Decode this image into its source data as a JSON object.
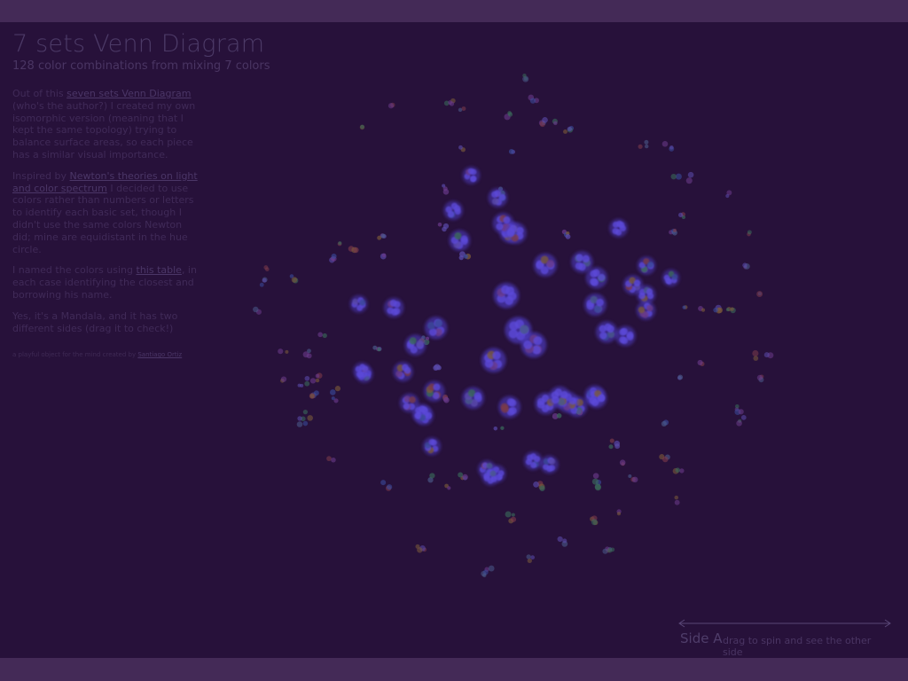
{
  "title": "7 sets Venn Diagram",
  "subtitle": "128 color combinations from mixing 7 colors",
  "description": {
    "p1": {
      "pre": "Out of this ",
      "link": "seven sets Venn Diagram",
      "post": " (who's the author?) I created my own isomorphic version (meaning that I kept the same topology) trying to balance surface areas, so each piece has a similar visual importance."
    },
    "p2": {
      "pre": "Inspired by ",
      "link": "Newton's theories on light and color spectrum",
      "post": " I decided to use colors rather than numbers or letters to identify each basic set, though I didn't use the same colors Newton did; mine are equidistant in the hue circle."
    },
    "p3": {
      "pre": "I named the colors using ",
      "link": "this table",
      "post": ", in each case identifying the closest and borrowing his name."
    },
    "p4": "Yes, it's a Mandala, and it has two different sides (drag it to check!)"
  },
  "credit": {
    "pre": "a playful object for the mind created by ",
    "link": "Santiago Ortiz"
  },
  "side": {
    "label": "Side A",
    "hint": "drag to spin and see the other side"
  },
  "colors": {
    "background": "#27113a",
    "bar": "#442a57",
    "cluster_core": "#4f3dc8",
    "dot_palette": [
      "#6a3a8a",
      "#3a6a5a",
      "#7a3a4a",
      "#5a4aaa",
      "#4a5a8a",
      "#7a5a3a",
      "#3a4a9a"
    ]
  },
  "mandala": {
    "seed": 7,
    "cluster_count": 140
  }
}
